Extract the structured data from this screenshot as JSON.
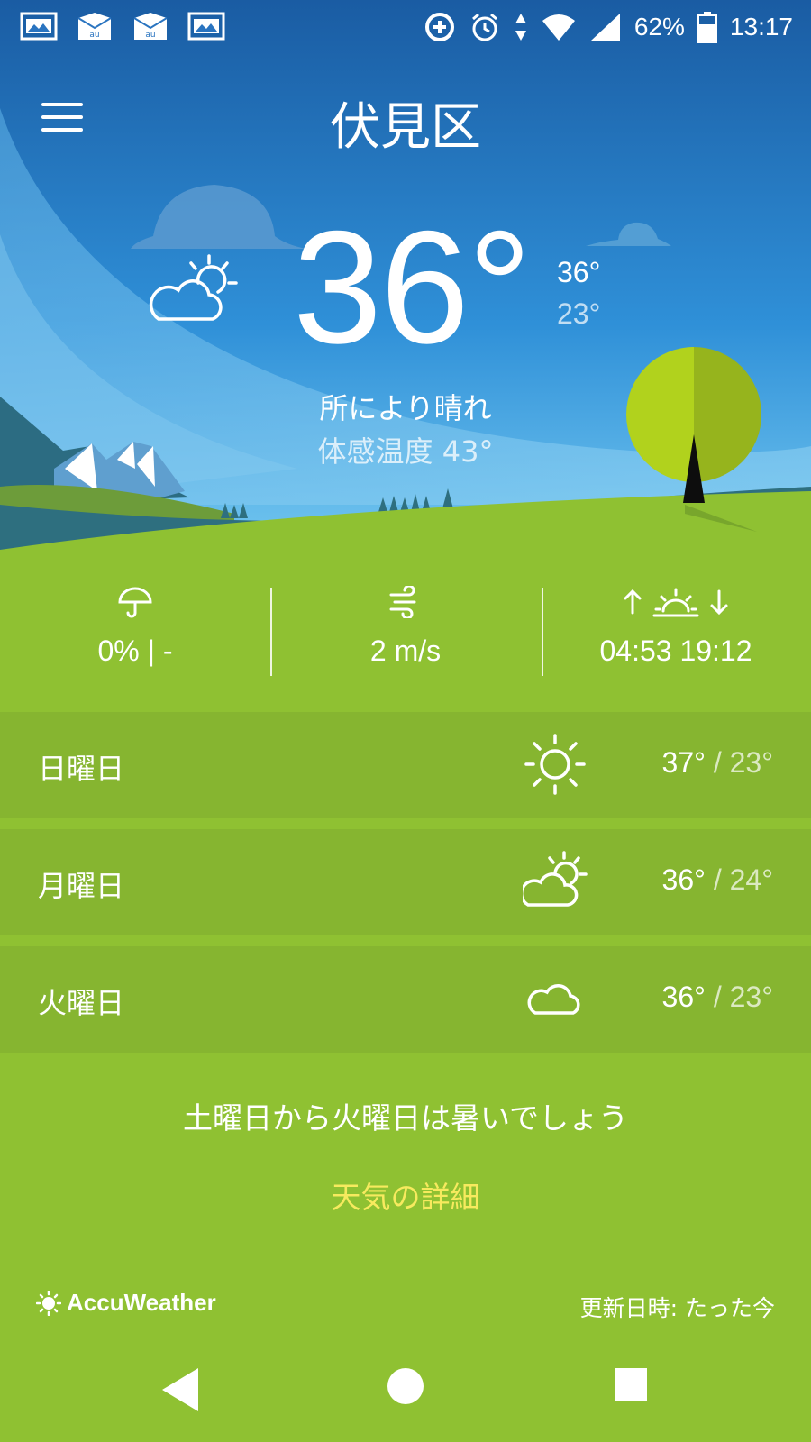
{
  "status_bar": {
    "battery": "62%",
    "time": "13:17",
    "left_icons": [
      "newspaper-icon",
      "au-mail-icon",
      "au-mail-icon",
      "newspaper-icon"
    ],
    "right_icons": [
      "data-saver-icon",
      "alarm-icon",
      "data-transfer-icon",
      "wifi-icon",
      "signal-icon",
      "battery-icon"
    ]
  },
  "header": {
    "city": "伏見区",
    "menu_icon": "hamburger-menu-icon"
  },
  "current": {
    "icon": "partly-sunny-icon",
    "temp": "36°",
    "high": "36°",
    "low": "23°",
    "condition": "所により晴れ",
    "feels_like": "体感温度 43°"
  },
  "stats": {
    "precip": {
      "icon": "umbrella-icon",
      "value": "0% | -"
    },
    "wind": {
      "icon": "wind-icon",
      "value": "2 m/s"
    },
    "sun": {
      "icon": "sunrise-sunset-icon",
      "value": "04:53  19:12"
    }
  },
  "forecast": [
    {
      "day": "日曜日",
      "icon": "sunny-icon",
      "high": "37°",
      "low": "/ 23°"
    },
    {
      "day": "月曜日",
      "icon": "partly-sunny-icon",
      "high": "36°",
      "low": "/ 24°"
    },
    {
      "day": "火曜日",
      "icon": "cloudy-icon",
      "high": "36°",
      "low": "/ 23°"
    }
  ],
  "summary": "土曜日から火曜日は暑いでしょう",
  "details_link": "天気の詳細",
  "footer": {
    "brand": "AccuWeather",
    "updated": "更新日時: たった今"
  },
  "colors": {
    "sky_top": "#1a5ca3",
    "sky_bottom": "#6fc4ef",
    "grass": "#8fc132",
    "forecast_row": "#86b530",
    "details_link": "#f7ea5e"
  },
  "nav": {
    "back": "back-icon",
    "home": "home-icon",
    "recents": "recents-icon"
  }
}
